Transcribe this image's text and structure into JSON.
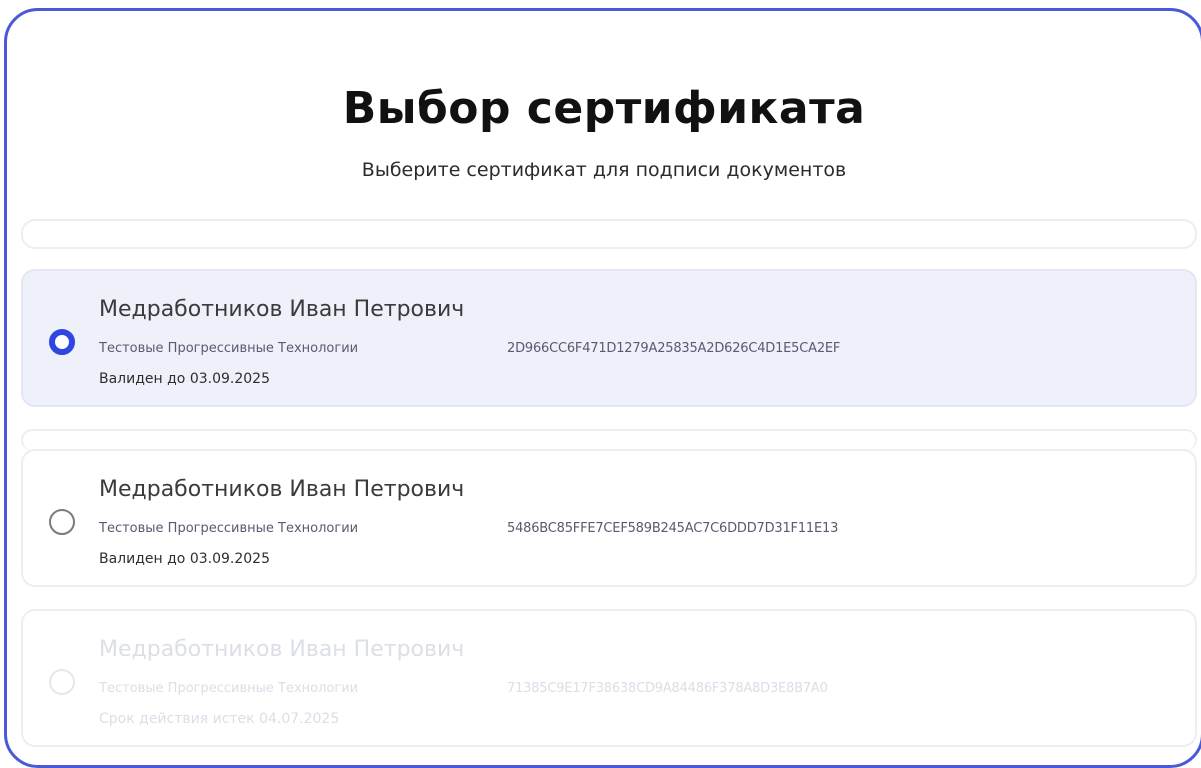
{
  "dialog": {
    "title": "Выбор сертификата",
    "subtitle": "Выберите сертификат для подписи документов"
  },
  "certificates": [
    {
      "name": "Медработников Иван Петрович",
      "organization": "Тестовые Прогрессивные Технологии",
      "thumbprint": "2D966CC6F471D1279A25835A2D626C4D1E5CA2EF",
      "validity": "Валиден до 03.09.2025",
      "selected": true,
      "expired": false
    },
    {
      "name": "Медработников Иван Петрович",
      "organization": "Тестовые Прогрессивные Технологии",
      "thumbprint": "5486BC85FFE7CEF589B245AC7C6DDD7D31F11E13",
      "validity": "Валиден до 03.09.2025",
      "selected": false,
      "expired": false
    },
    {
      "name": "Медработников Иван Петрович",
      "organization": "Тестовые Прогрессивные Технологии",
      "thumbprint": "71385C9E17F38638CD9A84486F378A8D3E8B7A0",
      "validity": "Срок действия истек 04.07.2025",
      "selected": false,
      "expired": true
    }
  ],
  "colors": {
    "accent": "#2f46e0",
    "frame_border": "#4a59d8",
    "selected_background": "#eef0fa"
  }
}
